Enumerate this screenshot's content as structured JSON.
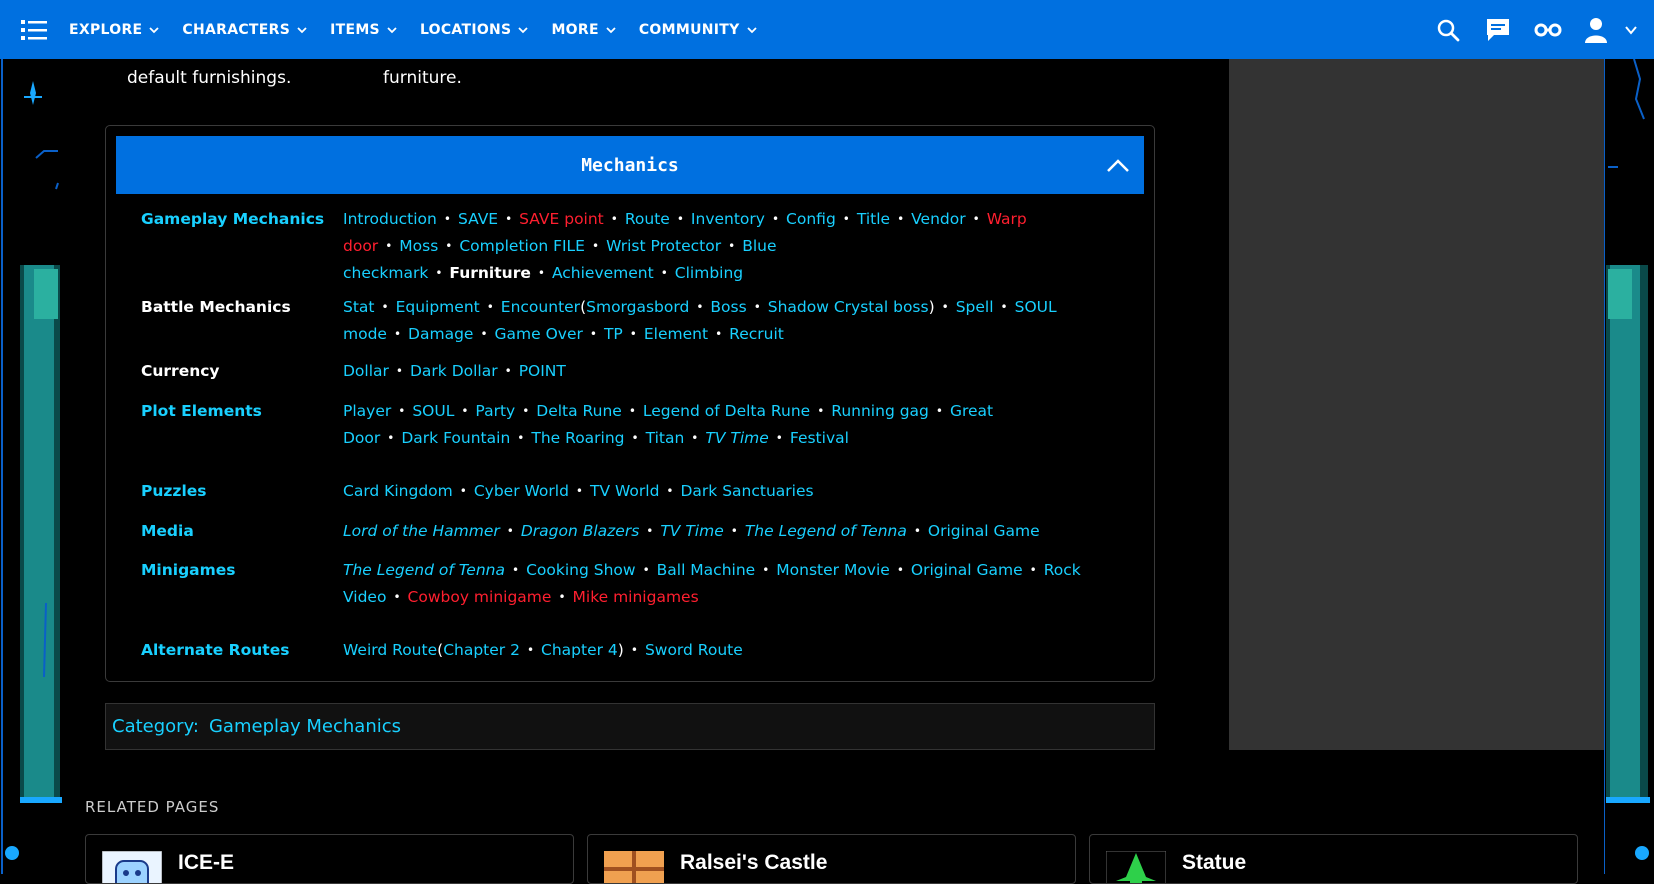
{
  "nav": {
    "items": [
      "EXPLORE",
      "CHARACTERS",
      "ITEMS",
      "LOCATIONS",
      "MORE",
      "COMMUNITY"
    ]
  },
  "intro": {
    "left_text": "default furnishings.",
    "right_text": "furniture."
  },
  "navbox": {
    "title": "Mechanics",
    "groups": [
      {
        "label": "Gameplay Mechanics",
        "label_link": true,
        "items": [
          {
            "text": "Introduction"
          },
          {
            "text": "SAVE"
          },
          {
            "text": "SAVE point",
            "red": true
          },
          {
            "text": "Route"
          },
          {
            "text": "Inventory"
          },
          {
            "text": "Config"
          },
          {
            "text": "Title"
          },
          {
            "text": "Vendor"
          },
          {
            "text": "Warp door",
            "red": true
          },
          {
            "text": "Moss"
          },
          {
            "text": "Completion FILE"
          },
          {
            "text": "Wrist Protector"
          },
          {
            "text": "Blue checkmark"
          },
          {
            "text": "Furniture",
            "bold": true
          },
          {
            "text": "Achievement"
          },
          {
            "text": "Climbing"
          }
        ]
      },
      {
        "label": "Battle Mechanics",
        "label_link": false,
        "items": [
          {
            "text": "Stat"
          },
          {
            "text": "Equipment"
          },
          {
            "text": "Encounter",
            "open": true
          },
          {
            "text": "Smorgasbord",
            "inner": true
          },
          {
            "text": "Boss",
            "inner": true
          },
          {
            "text": "Shadow Crystal boss",
            "inner": true,
            "close": true
          },
          {
            "text": "Spell"
          },
          {
            "text": "SOUL mode"
          },
          {
            "text": "Damage"
          },
          {
            "text": "Game Over"
          },
          {
            "text": "TP"
          },
          {
            "text": "Element"
          },
          {
            "text": "Recruit"
          }
        ]
      },
      {
        "label": "Currency",
        "label_link": false,
        "items": [
          {
            "text": "Dollar"
          },
          {
            "text": "Dark Dollar"
          },
          {
            "text": "POINT"
          }
        ]
      },
      {
        "label": "Plot Elements",
        "label_link": true,
        "items": [
          {
            "text": "Player"
          },
          {
            "text": "SOUL"
          },
          {
            "text": "Party"
          },
          {
            "text": "Delta Rune"
          },
          {
            "text": "Legend of Delta Rune"
          },
          {
            "text": "Running gag"
          },
          {
            "text": "Great Door"
          },
          {
            "text": "Dark Fountain"
          },
          {
            "text": "The Roaring"
          },
          {
            "text": "Titan"
          },
          {
            "text": "TV Time",
            "italic": true
          },
          {
            "text": "Festival"
          }
        ]
      },
      {
        "label": "Puzzles",
        "label_link": true,
        "items": [
          {
            "text": "Card Kingdom"
          },
          {
            "text": "Cyber World"
          },
          {
            "text": "TV World"
          },
          {
            "text": "Dark Sanctuaries"
          }
        ]
      },
      {
        "label": "Media",
        "label_link": true,
        "items": [
          {
            "text": "Lord of the Hammer",
            "italic": true
          },
          {
            "text": "Dragon Blazers",
            "italic": true
          },
          {
            "text": "TV Time",
            "italic": true
          },
          {
            "text": "The Legend of Tenna",
            "italic": true
          },
          {
            "text": "Original Game"
          }
        ]
      },
      {
        "label": "Minigames",
        "label_link": true,
        "items": [
          {
            "text": "The Legend of Tenna",
            "italic": true
          },
          {
            "text": "Cooking Show"
          },
          {
            "text": "Ball Machine"
          },
          {
            "text": "Monster Movie"
          },
          {
            "text": "Original Game"
          },
          {
            "text": "Rock Video"
          },
          {
            "text": "Cowboy minigame",
            "red": true
          },
          {
            "text": "Mike minigames",
            "red": true
          }
        ]
      },
      {
        "label": "Alternate Routes",
        "label_link": true,
        "items": [
          {
            "text": "Weird Route",
            "open": true
          },
          {
            "text": "Chapter 2",
            "inner": true
          },
          {
            "text": "Chapter 4",
            "inner": true,
            "close": true
          },
          {
            "text": "Sword Route"
          }
        ]
      }
    ]
  },
  "category": {
    "label": "Category:",
    "link": "Gameplay Mechanics"
  },
  "related": {
    "heading": "RELATED PAGES",
    "cards": [
      {
        "title": "ICE-E",
        "thumb": "ice-e-thumbnail"
      },
      {
        "title": "Ralsei's Castle",
        "thumb": "ralseis-castle-thumbnail"
      },
      {
        "title": "Statue",
        "thumb": "statue-thumbnail"
      }
    ]
  },
  "colors": {
    "brand_blue": "#0070e0",
    "link": "#19d0ff",
    "redlink": "#ff1f2f",
    "background": "#000000"
  },
  "icons": {
    "menu": "hamburger-list-icon",
    "search": "search-icon",
    "chat": "chat-icon",
    "glasses": "glasses-icon",
    "user": "user-icon",
    "collapse": "chevron-up-icon"
  }
}
